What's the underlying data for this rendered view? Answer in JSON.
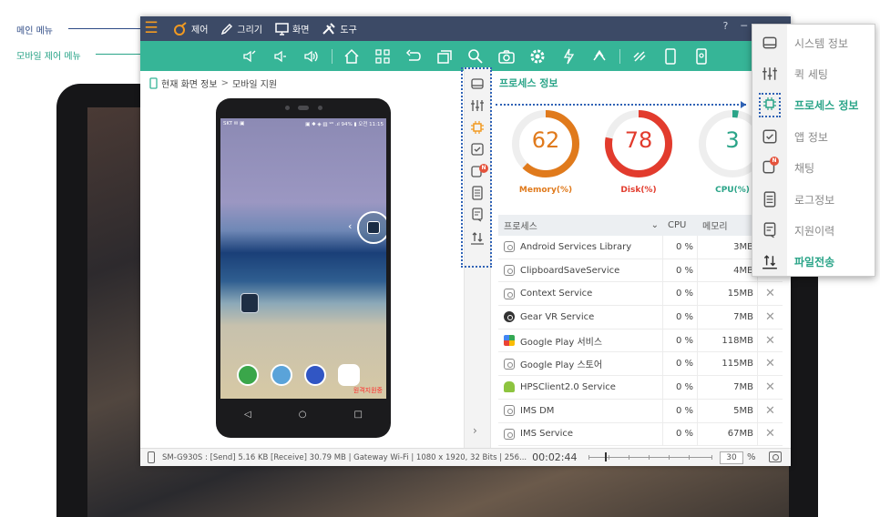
{
  "callouts": {
    "main_menu": "메인 메뉴",
    "mobile_menu": "모바일 제어 메뉴"
  },
  "menu": {
    "items": [
      {
        "label": "제어",
        "icon": "control-icon"
      },
      {
        "label": "그리기",
        "icon": "pen-icon"
      },
      {
        "label": "화면",
        "icon": "monitor-icon"
      },
      {
        "label": "도구",
        "icon": "tools-icon"
      }
    ],
    "help": "?",
    "minimize": "─"
  },
  "breadcrumb": {
    "current": "현재 화면 정보",
    "sep": ">",
    "target": "모바일 지원"
  },
  "phone": {
    "status_left": "SKT ✉ ▣",
    "status_right": "▣ ✱ ◈ ▥ ⁹ᴳ .ıl 94% ▮ 오전 11:15",
    "remote_tag": "원격지원중",
    "nav": [
      "◁",
      "○",
      "□"
    ]
  },
  "panel": {
    "title": "프로세스 정보"
  },
  "gauges": [
    {
      "value": "62",
      "label": "Memory(%)",
      "color": "#e07a1c",
      "percent": 62
    },
    {
      "value": "78",
      "label": "Disk(%)",
      "color": "#e23b2d",
      "percent": 78
    },
    {
      "value": "3",
      "label": "CPU(%)",
      "color": "#2aa488",
      "percent": 3
    }
  ],
  "table": {
    "headers": {
      "name": "프로세스",
      "cpu": "CPU",
      "mem": "메모리"
    },
    "rows": [
      {
        "name": "Android Services Library",
        "cpu": "0 %",
        "mem": "3MB",
        "icon": "app"
      },
      {
        "name": "ClipboardSaveService",
        "cpu": "0 %",
        "mem": "4MB",
        "icon": "app"
      },
      {
        "name": "Context Service",
        "cpu": "0 %",
        "mem": "15MB",
        "icon": "app"
      },
      {
        "name": "Gear VR Service",
        "cpu": "0 %",
        "mem": "7MB",
        "icon": "gear"
      },
      {
        "name": "Google  Play 서비스",
        "cpu": "0 %",
        "mem": "118MB",
        "icon": "gplay"
      },
      {
        "name": "Google  Play 스토어",
        "cpu": "0 %",
        "mem": "115MB",
        "icon": "app"
      },
      {
        "name": "HPSClient2.0 Service",
        "cpu": "0 %",
        "mem": "7MB",
        "icon": "android"
      },
      {
        "name": "IMS DM",
        "cpu": "0 %",
        "mem": "5MB",
        "icon": "app"
      },
      {
        "name": "IMS Service",
        "cpu": "0 %",
        "mem": "67MB",
        "icon": "app"
      }
    ],
    "close_glyph": "✕"
  },
  "status": {
    "info": "SM-G930S : [Send] 5.16 KB  [Receive] 30.79 MB | Gateway Wi-Fi | 1080 x 1920, 32 Bits | 256...",
    "timer": "00:02:44",
    "zoom": "30",
    "zoom_unit": "%"
  },
  "popup": {
    "items": [
      {
        "label": "시스템 정보",
        "icon": "drive-icon"
      },
      {
        "label": "퀵 세팅",
        "icon": "sliders-icon"
      },
      {
        "label": "프로세스 정보",
        "icon": "chip-icon"
      },
      {
        "label": "앱 정보",
        "icon": "check-box-icon"
      },
      {
        "label": "채팅",
        "icon": "chat-icon"
      },
      {
        "label": "로그정보",
        "icon": "log-icon"
      },
      {
        "label": "지원이력",
        "icon": "history-icon"
      },
      {
        "label": "파일전송",
        "icon": "file-transfer-icon"
      }
    ],
    "badge": "N"
  },
  "colors": {
    "titlebar": "#3c4a66",
    "toolbar": "#36b597",
    "accent": "#2aa488",
    "orange": "#f29a21"
  }
}
